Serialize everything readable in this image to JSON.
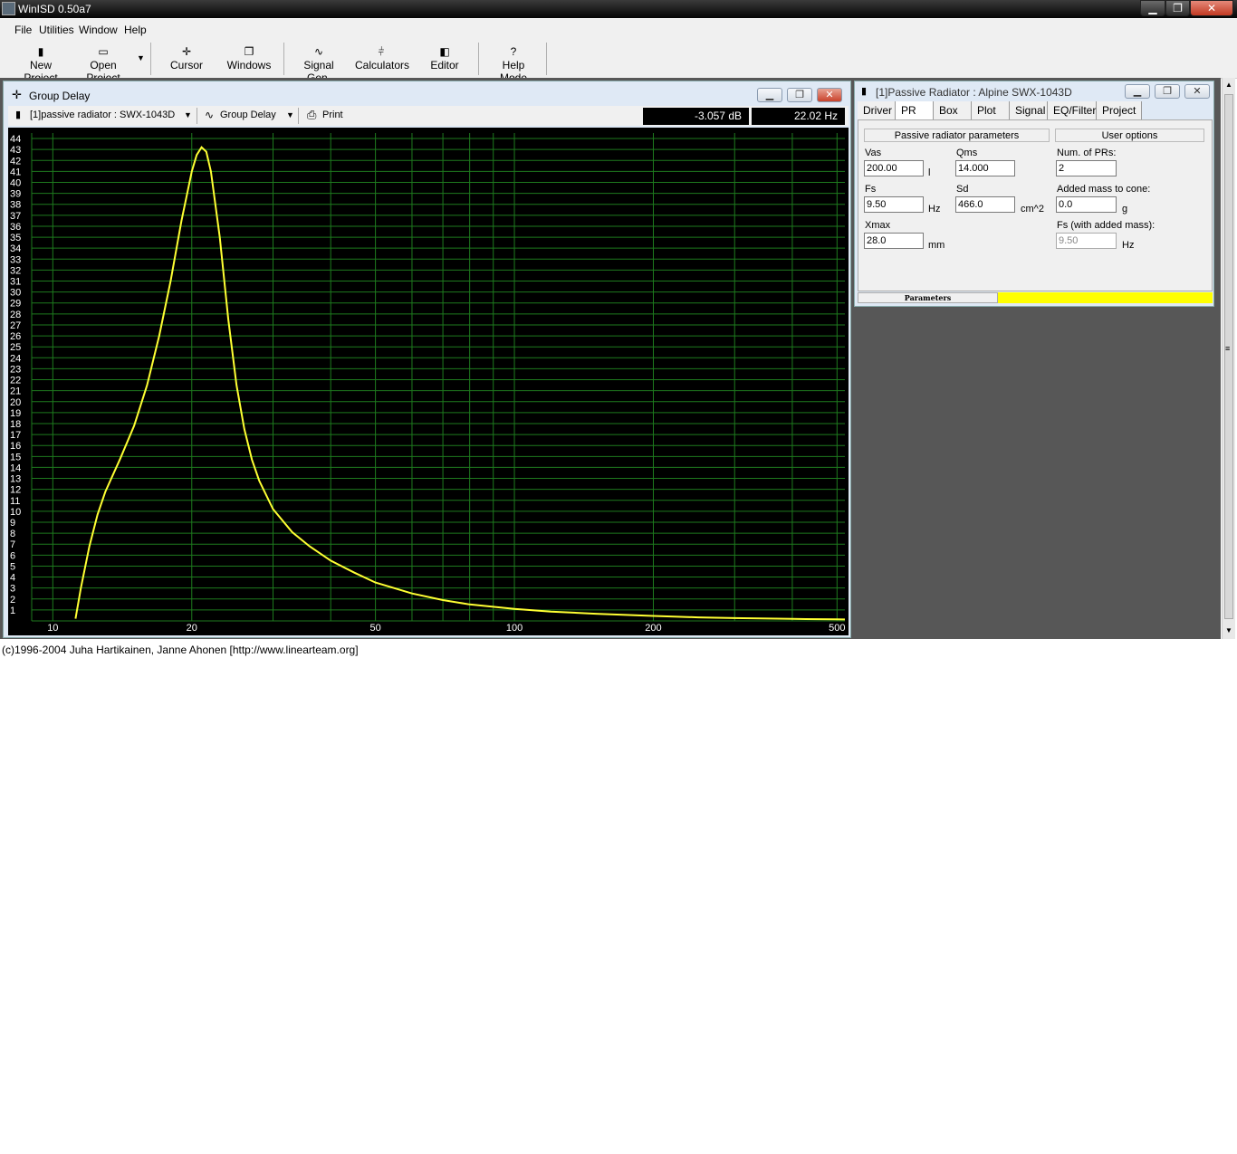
{
  "app": {
    "title": "WinISD 0.50a7"
  },
  "menu": [
    "File",
    "Utilities",
    "Window",
    "Help"
  ],
  "toolbar": [
    {
      "label": "New Project",
      "icon": "new-project-icon"
    },
    {
      "label": "Open Project",
      "icon": "open-project-icon"
    },
    {
      "label": "Cursor",
      "icon": "cursor-icon"
    },
    {
      "label": "Windows",
      "icon": "windows-icon"
    },
    {
      "label": "Signal Gen.",
      "icon": "signal-gen-icon"
    },
    {
      "label": "Calculators",
      "icon": "calculators-icon"
    },
    {
      "label": "Editor",
      "icon": "editor-icon"
    },
    {
      "label": "Help Mode",
      "icon": "help-icon"
    }
  ],
  "group_delay": {
    "title": "Group Delay",
    "project_select": "[1]passive radiator : SWX-1043D",
    "plot_select": "Group Delay",
    "print_label": "Print",
    "readout_db": "-3.057 dB",
    "readout_hz": "22.02 Hz"
  },
  "pr_window": {
    "title": "[1]Passive Radiator : Alpine SWX-1043D",
    "tabs": [
      "Driver",
      "PR",
      "Box",
      "Plot",
      "Signal",
      "EQ/Filter",
      "Project"
    ],
    "active_tab": "PR",
    "section_left": "Passive radiator parameters",
    "section_right": "User options",
    "fields": {
      "vas": {
        "label": "Vas",
        "value": "200.00",
        "unit": "l"
      },
      "qms": {
        "label": "Qms",
        "value": "14.000"
      },
      "fs": {
        "label": "Fs",
        "value": "9.50",
        "unit": "Hz"
      },
      "sd": {
        "label": "Sd",
        "value": "466.0",
        "unit": "cm^2"
      },
      "xmax": {
        "label": "Xmax",
        "value": "28.0",
        "unit": "mm"
      },
      "num_prs": {
        "label": "Num. of PRs:",
        "value": "2"
      },
      "added_mass": {
        "label": "Added mass to cone:",
        "value": "0.0",
        "unit": "g"
      },
      "fs_added": {
        "label": "Fs (with added mass):",
        "value": "9.50",
        "unit": "Hz"
      }
    },
    "status_tab": "Parameters"
  },
  "status": "(c)1996-2004 Juha Hartikainen, Janne Ahonen [http://www.linearteam.org]",
  "colors": {
    "plot_bg": "#000000",
    "grid": "#1e7a1e",
    "curve": "#ffff33",
    "status_yellow": "#ffff00"
  },
  "chart_data": {
    "type": "line",
    "x_scale": "log",
    "xlim": [
      9,
      520
    ],
    "ylim": [
      0,
      44.5
    ],
    "x_ticks": [
      10,
      20,
      50,
      100,
      200,
      500
    ],
    "y_ticks": [
      1,
      2,
      3,
      4,
      5,
      6,
      7,
      8,
      9,
      10,
      11,
      12,
      13,
      14,
      15,
      16,
      17,
      18,
      19,
      20,
      21,
      22,
      23,
      24,
      25,
      26,
      27,
      28,
      29,
      30,
      31,
      32,
      33,
      34,
      35,
      36,
      37,
      38,
      39,
      40,
      41,
      42,
      43,
      44
    ],
    "series": [
      {
        "x": [
          11.2,
          11.5,
          12,
          12.5,
          13,
          14,
          15,
          16,
          17,
          18,
          19,
          20,
          20.5,
          21,
          21.5,
          22,
          23,
          24,
          25,
          26,
          27,
          28,
          30,
          33,
          36,
          40,
          45,
          50,
          60,
          70,
          80,
          100,
          120,
          150,
          200,
          250,
          300,
          400,
          500,
          520
        ],
        "y": [
          0.2,
          3,
          6.8,
          9.7,
          11.8,
          14.8,
          17.8,
          21.5,
          26,
          31,
          36.5,
          41,
          42.5,
          43.2,
          42.8,
          41,
          35,
          27.5,
          21.5,
          17.5,
          14.7,
          12.8,
          10.2,
          8.1,
          6.8,
          5.5,
          4.4,
          3.5,
          2.5,
          1.9,
          1.5,
          1.1,
          0.85,
          0.65,
          0.45,
          0.32,
          0.26,
          0.18,
          0.14,
          0.13
        ]
      }
    ]
  }
}
